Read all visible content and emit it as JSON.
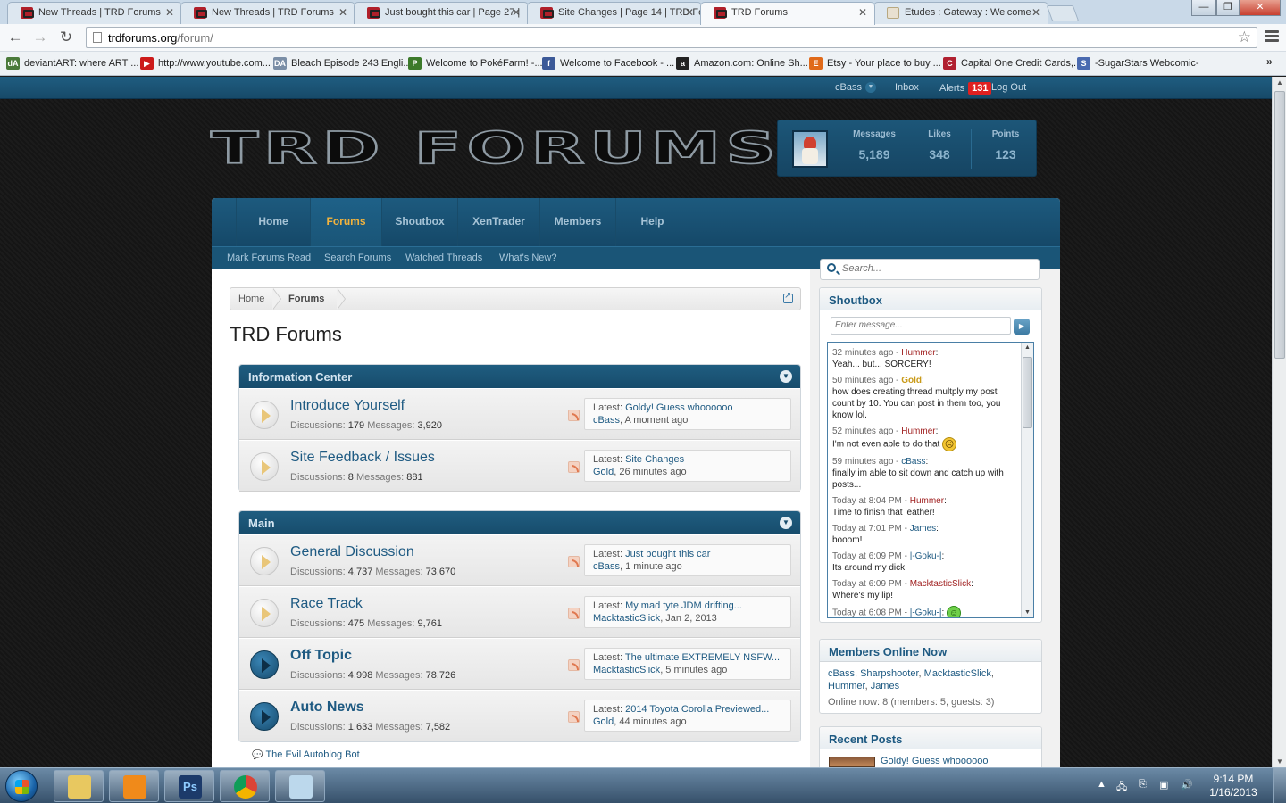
{
  "browser": {
    "tabs": [
      {
        "title": "New Threads | TRD Forums",
        "icon": "trd"
      },
      {
        "title": "New Threads | TRD Forums",
        "icon": "trd"
      },
      {
        "title": "Just bought this car | Page 27 |",
        "icon": "trd"
      },
      {
        "title": "Site Changes | Page 14 | TRD Fo",
        "icon": "trd"
      },
      {
        "title": "TRD Forums",
        "icon": "trd"
      },
      {
        "title": "Etudes : Gateway : Welcome",
        "icon": "etude"
      }
    ],
    "tab_close_glyph": "✕",
    "window_controls": {
      "minimize": "—",
      "maximize": "❐",
      "close": "✕"
    },
    "url_host": "trdforums.org",
    "url_path": "/forum/",
    "bookmarks": [
      {
        "label": "deviantART: where ART ...",
        "icon_text": "dA",
        "color": "#4a7a3a"
      },
      {
        "label": "http://www.youtube.com...",
        "icon_text": "▶",
        "color": "#cc1a1a"
      },
      {
        "label": "Bleach Episode 243 Engli...",
        "icon_text": "DA",
        "color": "#7a8ea6"
      },
      {
        "label": "Welcome to PokéFarm! -...",
        "icon_text": "P",
        "color": "#3c7a2a"
      },
      {
        "label": "Welcome to Facebook - ...",
        "icon_text": "f",
        "color": "#3b5998"
      },
      {
        "label": "Amazon.com: Online Sh...",
        "icon_text": "a",
        "color": "#222222"
      },
      {
        "label": "Etsy - Your place to buy ...",
        "icon_text": "E",
        "color": "#e06a1a"
      },
      {
        "label": "Capital One Credit Cards,...",
        "icon_text": "C",
        "color": "#b02030"
      },
      {
        "label": "-SugarStars Webcomic-",
        "icon_text": "S",
        "color": "#4a6ab0"
      }
    ],
    "bookmarks_more": "»"
  },
  "userbar": {
    "username": "cBass",
    "inbox": "Inbox",
    "alerts": "Alerts",
    "alerts_count": "131",
    "logout": "Log Out"
  },
  "logo_text": "TRD FORUMS",
  "stats": [
    {
      "label": "Messages",
      "value": "5,189"
    },
    {
      "label": "Likes",
      "value": "348"
    },
    {
      "label": "Points",
      "value": "123"
    }
  ],
  "nav": {
    "tabs": [
      "Home",
      "Forums",
      "Shoutbox",
      "XenTrader",
      "Members",
      "Help"
    ],
    "active": "Forums",
    "subnav": [
      "Mark Forums Read",
      "Search Forums",
      "Watched Threads",
      "What's New?"
    ]
  },
  "breadcrumb": [
    "Home",
    "Forums"
  ],
  "page_title": "TRD Forums",
  "categories": [
    {
      "title": "Information Center",
      "forums": [
        {
          "name": "Introduce Yourself",
          "discussions": "179",
          "messages": "3,920",
          "latest": "Goldy! Guess whoooooo",
          "user": "cBass",
          "time": "A moment ago",
          "unread": false
        },
        {
          "name": "Site Feedback / Issues",
          "discussions": "8",
          "messages": "881",
          "latest": "Site Changes",
          "user": "Gold",
          "time": "26 minutes ago",
          "unread": false
        }
      ]
    },
    {
      "title": "Main",
      "forums": [
        {
          "name": "General Discussion",
          "discussions": "4,737",
          "messages": "73,670",
          "latest": "Just bought this car",
          "user": "cBass",
          "time": "1 minute ago",
          "unread": false
        },
        {
          "name": "Race Track",
          "discussions": "475",
          "messages": "9,761",
          "latest": "My mad tyte JDM drifting...",
          "user": "MacktasticSlick",
          "time": "Jan 2, 2013",
          "unread": false
        },
        {
          "name": "Off Topic",
          "discussions": "4,998",
          "messages": "78,726",
          "latest": "The ultimate EXTREMELY NSFW...",
          "user": "MacktasticSlick",
          "time": "5 minutes ago",
          "unread": true
        },
        {
          "name": "Auto News",
          "discussions": "1,633",
          "messages": "7,582",
          "latest": "2014 Toyota Corolla Previewed...",
          "user": "Gold",
          "time": "44 minutes ago",
          "unread": true
        }
      ]
    }
  ],
  "labels": {
    "discussions": "Discussions:",
    "messages": "Messages:",
    "latest": "Latest:"
  },
  "evil_bot": "The Evil Autoblog Bot",
  "search_placeholder": "Search...",
  "shoutbox": {
    "title": "Shoutbox",
    "placeholder": "Enter message...",
    "messages": [
      {
        "time": "32 minutes ago",
        "user": "Hummer",
        "style": "red",
        "text": "Yeah... but... SORCERY!",
        "emoji": ""
      },
      {
        "time": "50 minutes ago",
        "user": "Gold",
        "style": "gold",
        "text": "how does creating thread multply my post count by 10. You can post in them too, you know lol.",
        "emoji": ""
      },
      {
        "time": "52 minutes ago",
        "user": "Hummer",
        "style": "red",
        "text": "I'm not even able to do that",
        "emoji": "sad"
      },
      {
        "time": "59 minutes ago",
        "user": "cBass",
        "style": "blue",
        "text": "finally im able to sit down and catch up with posts...",
        "emoji": ""
      },
      {
        "time": "Today at 8:04 PM",
        "user": "Hummer",
        "style": "red",
        "text": "Time to finish that leather!",
        "emoji": ""
      },
      {
        "time": "Today at 7:01 PM",
        "user": "James",
        "style": "blue",
        "text": "booom!",
        "emoji": ""
      },
      {
        "time": "Today at 6:09 PM",
        "user": "|-Goku-|",
        "style": "blue",
        "text": "Its around my dick.",
        "emoji": ""
      },
      {
        "time": "Today at 6:09 PM",
        "user": "MacktasticSlick",
        "style": "red",
        "text": "Where's my lip!",
        "emoji": ""
      },
      {
        "time": "Today at 6:08 PM",
        "user": "|-Goku-|",
        "style": "blue",
        "text": "",
        "emoji": "grin"
      }
    ]
  },
  "members_online": {
    "title": "Members Online Now",
    "names": [
      "cBass",
      "Sharpshooter",
      "MacktasticSlick",
      "Hummer",
      "James"
    ],
    "count": "Online now: 8 (members: 5, guests: 3)"
  },
  "recent_posts": {
    "title": "Recent Posts",
    "first": "Goldy! Guess whoooooo"
  },
  "taskbar": {
    "apps": [
      {
        "name": "explorer",
        "color": "#e8c860"
      },
      {
        "name": "media-player",
        "color": "#f08a1a"
      },
      {
        "name": "photoshop",
        "color": "#1c3a6a",
        "text": "Ps"
      },
      {
        "name": "chrome",
        "color": "#3aa04a"
      },
      {
        "name": "notepad",
        "color": "#bcd8ec"
      }
    ],
    "time": "9:14 PM",
    "date": "1/16/2013"
  }
}
